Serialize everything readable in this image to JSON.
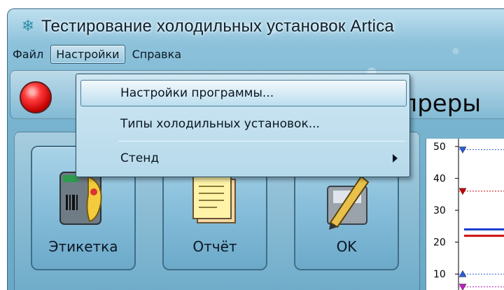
{
  "window": {
    "title": "Тестирование холодильных установок Artica",
    "title_icon": "snowflake-icon"
  },
  "menubar": {
    "items": [
      {
        "label": "Файл"
      },
      {
        "label": "Настройки",
        "active": true
      },
      {
        "label": "Справка"
      }
    ]
  },
  "header": {
    "status_color": "#ff3b3b",
    "text": "преры"
  },
  "dropdown": {
    "items": [
      {
        "label": "Настройки программы...",
        "highlighted": true
      },
      {
        "label": "Типы холодильных установок..."
      },
      {
        "label": "Стенд",
        "has_submenu": true,
        "submenu_icon": "chevron-right-icon"
      }
    ]
  },
  "actions": [
    {
      "label": "Этикетка",
      "icon": "label-printer-icon"
    },
    {
      "label": "Отчёт",
      "icon": "report-icon"
    },
    {
      "label": "OK",
      "icon": "ok-pencil-icon"
    }
  ],
  "chart_data": {
    "type": "line",
    "y_ticks": [
      "50",
      "40",
      "30",
      "20",
      "10"
    ],
    "ylim": [
      5,
      52
    ],
    "series": [
      {
        "color": "#2a5bd7",
        "marker": "triangle-down",
        "values": [
          49
        ]
      },
      {
        "color": "#c40000",
        "marker": "triangle-down",
        "values": [
          36
        ]
      },
      {
        "color": "#1a3fd0",
        "marker": "line",
        "values": [
          24
        ]
      },
      {
        "color": "#d01010",
        "marker": "line",
        "values": [
          22
        ]
      },
      {
        "color": "#2a5bd7",
        "marker": "triangle-up",
        "values": [
          10
        ]
      },
      {
        "color": "#c020c0",
        "marker": "triangle-down",
        "values": [
          6
        ]
      }
    ]
  }
}
